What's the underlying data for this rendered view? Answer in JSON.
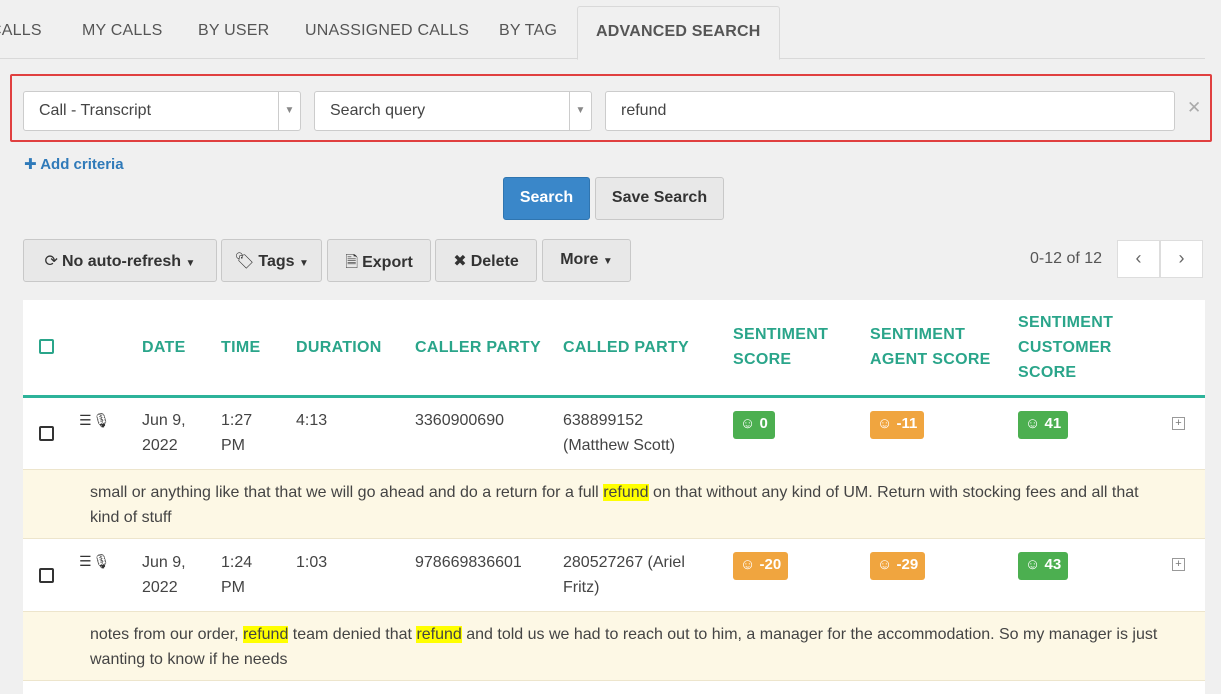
{
  "tabs": [
    {
      "label": "CALLS"
    },
    {
      "label": "MY CALLS"
    },
    {
      "label": "BY USER"
    },
    {
      "label": "UNASSIGNED CALLS"
    },
    {
      "label": "BY TAG"
    },
    {
      "label": "ADVANCED SEARCH",
      "active": true
    }
  ],
  "criteria": {
    "field": "Call - Transcript",
    "operator": "Search query",
    "value": "refund",
    "remove_icon": "close-icon",
    "add_label": "Add criteria"
  },
  "actions": {
    "search": "Search",
    "save_search": "Save Search"
  },
  "toolbar": {
    "auto_refresh": "No auto-refresh",
    "tags": "Tags",
    "export": "Export",
    "delete": "Delete",
    "more": "More",
    "pager_text": "0-12 of 12"
  },
  "table": {
    "headers": {
      "date": "DATE",
      "time": "TIME",
      "duration": "DURATION",
      "caller": "CALLER PARTY",
      "called": "CALLED PARTY",
      "sentiment_l1": "SENTIMENT",
      "sentiment_l2": "SCORE",
      "agent_l1": "SENTIMENT",
      "agent_l2": "AGENT SCORE",
      "customer_l1": "SENTIMENT",
      "customer_l2": "CUSTOMER",
      "customer_l3": "SCORE"
    },
    "rows": [
      {
        "date_l1": "Jun 9,",
        "date_l2": "2022",
        "time_l1": "1:27",
        "time_l2": "PM",
        "duration": "4:13",
        "caller": "3360900690",
        "called_l1": "638899152",
        "called_l2": "(Matthew Scott)",
        "sentiment": "0",
        "agent": "-11",
        "customer": "41",
        "snippet": {
          "before": "small or anything like that that we will go ahead and do a return for a full ",
          "hl1": "refund",
          "after": " on that without any kind of UM. Return with stocking fees and all that kind of stuff"
        }
      },
      {
        "date_l1": "Jun 9,",
        "date_l2": "2022",
        "time_l1": "1:24",
        "time_l2": "PM",
        "duration": "1:03",
        "caller": "978669836601",
        "called_l1": "280527267 (Ariel",
        "called_l2": "Fritz)",
        "sentiment": "-20",
        "agent": "-29",
        "customer": "43",
        "snippet": {
          "before": "notes from our order, ",
          "hl1": "refund",
          "middle": " team denied that ",
          "hl2": "refund",
          "after": " and told us we had to reach out to him, a manager for the accommodation. So my manager is just wanting to know if he needs"
        }
      }
    ]
  }
}
